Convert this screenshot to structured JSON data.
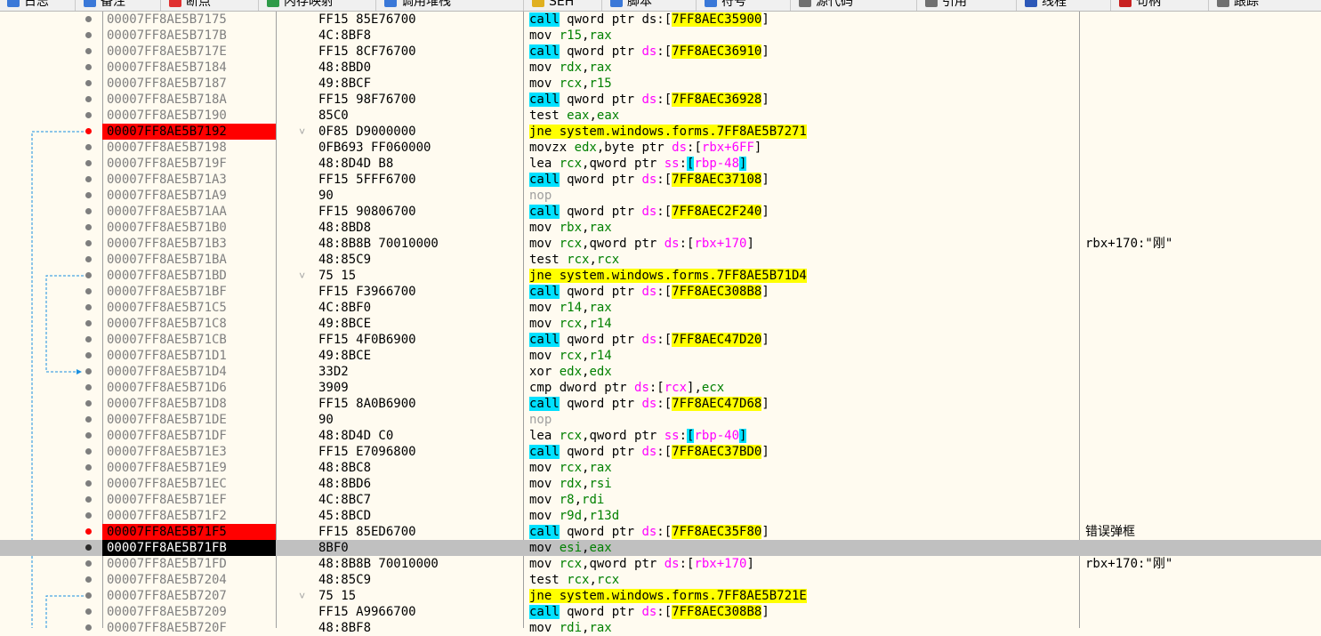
{
  "toolbar": {
    "tabs": [
      {
        "label": "日志",
        "color": "#3a78d8"
      },
      {
        "label": "备注",
        "color": "#3a78d8"
      },
      {
        "label": "断点",
        "color": "#e03030"
      },
      {
        "label": "内存映射",
        "color": "#2e9a48"
      },
      {
        "label": "调用堆栈",
        "color": "#3a78d8"
      },
      {
        "label": "SEH",
        "color": "#e0b020"
      },
      {
        "label": "脚本",
        "color": "#3a78d8"
      },
      {
        "label": "符号",
        "color": "#3a78d8"
      },
      {
        "label": "源代码",
        "color": "#707070"
      },
      {
        "label": "引用",
        "color": "#707070"
      },
      {
        "label": "线程",
        "color": "#2c58b8"
      },
      {
        "label": "句柄",
        "color": "#c82020"
      },
      {
        "label": "跟踪",
        "color": "#707070"
      }
    ]
  },
  "rows": [
    {
      "addr": "00007FF8AE5B7175",
      "bytes": "FF15 85E76700",
      "dis": [
        [
          "call",
          "k-call"
        ],
        [
          " qword ptr ",
          ""
        ],
        [
          "ds",
          ""
        ],
        [
          ":[",
          ""
        ],
        [
          "7FF8AEC35900",
          "k-lbl"
        ],
        [
          "]",
          ""
        ]
      ],
      "comment": ""
    },
    {
      "addr": "00007FF8AE5B717B",
      "bytes": "4C:8BF8",
      "dis": [
        [
          "mov ",
          ""
        ],
        [
          "r15",
          "k-reg"
        ],
        [
          ",",
          ""
        ],
        [
          "rax",
          "k-reg"
        ]
      ],
      "comment": ""
    },
    {
      "addr": "00007FF8AE5B717E",
      "bytes": "FF15 8CF76700",
      "dis": [
        [
          "call",
          "k-call"
        ],
        [
          " qword ptr ",
          ""
        ],
        [
          "ds",
          "k-seg"
        ],
        [
          ":[",
          ""
        ],
        [
          "7FF8AEC36910",
          "k-lbl"
        ],
        [
          "]",
          ""
        ]
      ],
      "comment": ""
    },
    {
      "addr": "00007FF8AE5B7184",
      "bytes": "48:8BD0",
      "dis": [
        [
          "mov ",
          ""
        ],
        [
          "rdx",
          "k-reg"
        ],
        [
          ",",
          ""
        ],
        [
          "rax",
          "k-reg"
        ]
      ],
      "comment": ""
    },
    {
      "addr": "00007FF8AE5B7187",
      "bytes": "49:8BCF",
      "dis": [
        [
          "mov ",
          ""
        ],
        [
          "rcx",
          "k-reg"
        ],
        [
          ",",
          ""
        ],
        [
          "r15",
          "k-reg"
        ]
      ],
      "comment": ""
    },
    {
      "addr": "00007FF8AE5B718A",
      "bytes": "FF15 98F76700",
      "dis": [
        [
          "call",
          "k-call"
        ],
        [
          " qword ptr ",
          ""
        ],
        [
          "ds",
          "k-seg"
        ],
        [
          ":[",
          ""
        ],
        [
          "7FF8AEC36928",
          "k-lbl"
        ],
        [
          "]",
          ""
        ]
      ],
      "comment": ""
    },
    {
      "addr": "00007FF8AE5B7190",
      "bytes": "85C0",
      "dis": [
        [
          "test ",
          ""
        ],
        [
          "eax",
          "k-reg"
        ],
        [
          ",",
          ""
        ],
        [
          "eax",
          "k-reg"
        ]
      ],
      "comment": ""
    },
    {
      "addr": "00007FF8AE5B7192",
      "bytes": "0F85 D9000000",
      "bp": true,
      "fold": true,
      "dis": [
        [
          "jne system.windows.forms.7FF8AE5B7271",
          "k-jmp"
        ]
      ],
      "comment": ""
    },
    {
      "addr": "00007FF8AE5B7198",
      "bytes": "0FB693 FF060000",
      "dis": [
        [
          "movzx ",
          ""
        ],
        [
          "edx",
          "k-reg"
        ],
        [
          ",byte ptr ",
          ""
        ],
        [
          "ds",
          "k-seg"
        ],
        [
          ":[",
          ""
        ],
        [
          "rbx+6FF",
          "k-seg"
        ],
        [
          "]",
          ""
        ]
      ],
      "comment": ""
    },
    {
      "addr": "00007FF8AE5B719F",
      "bytes": "48:8D4D B8",
      "dis": [
        [
          "lea ",
          ""
        ],
        [
          "rcx",
          "k-reg"
        ],
        [
          ",qword ptr ",
          ""
        ],
        [
          "ss",
          "k-seg"
        ],
        [
          ":",
          ""
        ],
        [
          "[",
          "k-br"
        ],
        [
          "rbp-48",
          "k-seg"
        ],
        [
          "]",
          "k-br"
        ]
      ],
      "comment": ""
    },
    {
      "addr": "00007FF8AE5B71A3",
      "bytes": "FF15 5FFF6700",
      "dis": [
        [
          "call",
          "k-call"
        ],
        [
          " qword ptr ",
          ""
        ],
        [
          "ds",
          "k-seg"
        ],
        [
          ":[",
          ""
        ],
        [
          "7FF8AEC37108",
          "k-lbl"
        ],
        [
          "]",
          ""
        ]
      ],
      "comment": ""
    },
    {
      "addr": "00007FF8AE5B71A9",
      "bytes": "90",
      "dis": [
        [
          "nop",
          "k-nop"
        ]
      ],
      "comment": ""
    },
    {
      "addr": "00007FF8AE5B71AA",
      "bytes": "FF15 90806700",
      "dis": [
        [
          "call",
          "k-call"
        ],
        [
          " qword ptr ",
          ""
        ],
        [
          "ds",
          "k-seg"
        ],
        [
          ":[",
          ""
        ],
        [
          "7FF8AEC2F240",
          "k-lbl"
        ],
        [
          "]",
          ""
        ]
      ],
      "comment": ""
    },
    {
      "addr": "00007FF8AE5B71B0",
      "bytes": "48:8BD8",
      "dis": [
        [
          "mov ",
          ""
        ],
        [
          "rbx",
          "k-reg"
        ],
        [
          ",",
          ""
        ],
        [
          "rax",
          "k-reg"
        ]
      ],
      "comment": ""
    },
    {
      "addr": "00007FF8AE5B71B3",
      "bytes": "48:8B8B 70010000",
      "dis": [
        [
          "mov ",
          ""
        ],
        [
          "rcx",
          "k-reg"
        ],
        [
          ",qword ptr ",
          ""
        ],
        [
          "ds",
          "k-seg"
        ],
        [
          ":[",
          ""
        ],
        [
          "rbx+170",
          "k-seg"
        ],
        [
          "]",
          ""
        ]
      ],
      "comment": "rbx+170:\"刚\""
    },
    {
      "addr": "00007FF8AE5B71BA",
      "bytes": "48:85C9",
      "dis": [
        [
          "test ",
          ""
        ],
        [
          "rcx",
          "k-reg"
        ],
        [
          ",",
          ""
        ],
        [
          "rcx",
          "k-reg"
        ]
      ],
      "comment": ""
    },
    {
      "addr": "00007FF8AE5B71BD",
      "bytes": "75 15",
      "fold": true,
      "dis": [
        [
          "jne system.windows.forms.7FF8AE5B71D4",
          "k-jmp"
        ]
      ],
      "comment": ""
    },
    {
      "addr": "00007FF8AE5B71BF",
      "bytes": "FF15 F3966700",
      "dis": [
        [
          "call",
          "k-call"
        ],
        [
          " qword ptr ",
          ""
        ],
        [
          "ds",
          "k-seg"
        ],
        [
          ":[",
          ""
        ],
        [
          "7FF8AEC308B8",
          "k-lbl"
        ],
        [
          "]",
          ""
        ]
      ],
      "comment": ""
    },
    {
      "addr": "00007FF8AE5B71C5",
      "bytes": "4C:8BF0",
      "dis": [
        [
          "mov ",
          ""
        ],
        [
          "r14",
          "k-reg"
        ],
        [
          ",",
          ""
        ],
        [
          "rax",
          "k-reg"
        ]
      ],
      "comment": ""
    },
    {
      "addr": "00007FF8AE5B71C8",
      "bytes": "49:8BCE",
      "dis": [
        [
          "mov ",
          ""
        ],
        [
          "rcx",
          "k-reg"
        ],
        [
          ",",
          ""
        ],
        [
          "r14",
          "k-reg"
        ]
      ],
      "comment": ""
    },
    {
      "addr": "00007FF8AE5B71CB",
      "bytes": "FF15 4F0B6900",
      "dis": [
        [
          "call",
          "k-call"
        ],
        [
          " qword ptr ",
          ""
        ],
        [
          "ds",
          "k-seg"
        ],
        [
          ":[",
          ""
        ],
        [
          "7FF8AEC47D20",
          "k-lbl"
        ],
        [
          "]",
          ""
        ]
      ],
      "comment": ""
    },
    {
      "addr": "00007FF8AE5B71D1",
      "bytes": "49:8BCE",
      "dis": [
        [
          "mov ",
          ""
        ],
        [
          "rcx",
          "k-reg"
        ],
        [
          ",",
          ""
        ],
        [
          "r14",
          "k-reg"
        ]
      ],
      "comment": ""
    },
    {
      "addr": "00007FF8AE5B71D4",
      "bytes": "33D2",
      "dis": [
        [
          "xor ",
          ""
        ],
        [
          "edx",
          "k-reg"
        ],
        [
          ",",
          ""
        ],
        [
          "edx",
          "k-reg"
        ]
      ],
      "comment": ""
    },
    {
      "addr": "00007FF8AE5B71D6",
      "bytes": "3909",
      "dis": [
        [
          "cmp dword ptr ",
          ""
        ],
        [
          "ds",
          "k-seg"
        ],
        [
          ":[",
          ""
        ],
        [
          "rcx",
          "k-seg"
        ],
        [
          "],",
          ""
        ],
        [
          "ecx",
          "k-reg"
        ]
      ],
      "comment": ""
    },
    {
      "addr": "00007FF8AE5B71D8",
      "bytes": "FF15 8A0B6900",
      "dis": [
        [
          "call",
          "k-call"
        ],
        [
          " qword ptr ",
          ""
        ],
        [
          "ds",
          "k-seg"
        ],
        [
          ":[",
          ""
        ],
        [
          "7FF8AEC47D68",
          "k-lbl"
        ],
        [
          "]",
          ""
        ]
      ],
      "comment": ""
    },
    {
      "addr": "00007FF8AE5B71DE",
      "bytes": "90",
      "dis": [
        [
          "nop",
          "k-nop"
        ]
      ],
      "comment": ""
    },
    {
      "addr": "00007FF8AE5B71DF",
      "bytes": "48:8D4D C0",
      "dis": [
        [
          "lea ",
          ""
        ],
        [
          "rcx",
          "k-reg"
        ],
        [
          ",qword ptr ",
          ""
        ],
        [
          "ss",
          "k-seg"
        ],
        [
          ":",
          ""
        ],
        [
          "[",
          "k-br"
        ],
        [
          "rbp-40",
          "k-seg"
        ],
        [
          "]",
          "k-br"
        ]
      ],
      "comment": ""
    },
    {
      "addr": "00007FF8AE5B71E3",
      "bytes": "FF15 E7096800",
      "dis": [
        [
          "call",
          "k-call"
        ],
        [
          " qword ptr ",
          ""
        ],
        [
          "ds",
          "k-seg"
        ],
        [
          ":[",
          ""
        ],
        [
          "7FF8AEC37BD0",
          "k-lbl"
        ],
        [
          "]",
          ""
        ]
      ],
      "comment": ""
    },
    {
      "addr": "00007FF8AE5B71E9",
      "bytes": "48:8BC8",
      "dis": [
        [
          "mov ",
          ""
        ],
        [
          "rcx",
          "k-reg"
        ],
        [
          ",",
          ""
        ],
        [
          "rax",
          "k-reg"
        ]
      ],
      "comment": ""
    },
    {
      "addr": "00007FF8AE5B71EC",
      "bytes": "48:8BD6",
      "dis": [
        [
          "mov ",
          ""
        ],
        [
          "rdx",
          "k-reg"
        ],
        [
          ",",
          ""
        ],
        [
          "rsi",
          "k-reg"
        ]
      ],
      "comment": ""
    },
    {
      "addr": "00007FF8AE5B71EF",
      "bytes": "4C:8BC7",
      "dis": [
        [
          "mov ",
          ""
        ],
        [
          "r8",
          "k-reg"
        ],
        [
          ",",
          ""
        ],
        [
          "rdi",
          "k-reg"
        ]
      ],
      "comment": ""
    },
    {
      "addr": "00007FF8AE5B71F2",
      "bytes": "45:8BCD",
      "dis": [
        [
          "mov ",
          ""
        ],
        [
          "r9d",
          "k-reg"
        ],
        [
          ",",
          ""
        ],
        [
          "r13d",
          "k-reg"
        ]
      ],
      "comment": ""
    },
    {
      "addr": "00007FF8AE5B71F5",
      "bytes": "FF15 85ED6700",
      "bp": true,
      "dis": [
        [
          "call",
          "k-call"
        ],
        [
          " qword ptr ",
          ""
        ],
        [
          "ds",
          "k-seg"
        ],
        [
          ":[",
          ""
        ],
        [
          "7FF8AEC35F80",
          "k-lbl"
        ],
        [
          "]",
          ""
        ]
      ],
      "comment": "错误弹框",
      "cn": true
    },
    {
      "addr": "00007FF8AE5B71FB",
      "bytes": "8BF0",
      "cip": true,
      "dis": [
        [
          "mov ",
          ""
        ],
        [
          "esi",
          "k-reg"
        ],
        [
          ",",
          ""
        ],
        [
          "eax",
          "k-reg"
        ]
      ],
      "comment": ""
    },
    {
      "addr": "00007FF8AE5B71FD",
      "bytes": "48:8B8B 70010000",
      "dis": [
        [
          "mov ",
          ""
        ],
        [
          "rcx",
          "k-reg"
        ],
        [
          ",qword ptr ",
          ""
        ],
        [
          "ds",
          "k-seg"
        ],
        [
          ":[",
          ""
        ],
        [
          "rbx+170",
          "k-seg"
        ],
        [
          "]",
          ""
        ]
      ],
      "comment": "rbx+170:\"刚\""
    },
    {
      "addr": "00007FF8AE5B7204",
      "bytes": "48:85C9",
      "dis": [
        [
          "test ",
          ""
        ],
        [
          "rcx",
          "k-reg"
        ],
        [
          ",",
          ""
        ],
        [
          "rcx",
          "k-reg"
        ]
      ],
      "comment": ""
    },
    {
      "addr": "00007FF8AE5B7207",
      "bytes": "75 15",
      "fold": true,
      "dis": [
        [
          "jne system.windows.forms.7FF8AE5B721E",
          "k-jmp"
        ]
      ],
      "comment": ""
    },
    {
      "addr": "00007FF8AE5B7209",
      "bytes": "FF15 A9966700",
      "dis": [
        [
          "call",
          "k-call"
        ],
        [
          " qword ptr ",
          ""
        ],
        [
          "ds",
          "k-seg"
        ],
        [
          ":[",
          ""
        ],
        [
          "7FF8AEC308B8",
          "k-lbl"
        ],
        [
          "]",
          ""
        ]
      ],
      "comment": ""
    },
    {
      "addr": "00007FF8AE5B720F",
      "bytes": "48:8BF8",
      "dis": [
        [
          "mov ",
          ""
        ],
        [
          "rdi",
          "k-reg"
        ],
        [
          ",",
          ""
        ],
        [
          "rax",
          "k-reg"
        ]
      ],
      "comment": ""
    }
  ],
  "jump_arrows": [
    {
      "from_row": 7,
      "to_row": 38,
      "color": "#1a8fe0"
    },
    {
      "from_row": 16,
      "to_row": 22,
      "color": "#1a8fe0"
    },
    {
      "from_row": 36,
      "to_row": 38,
      "color": "#1a8fe0"
    }
  ],
  "cip_row": 33
}
